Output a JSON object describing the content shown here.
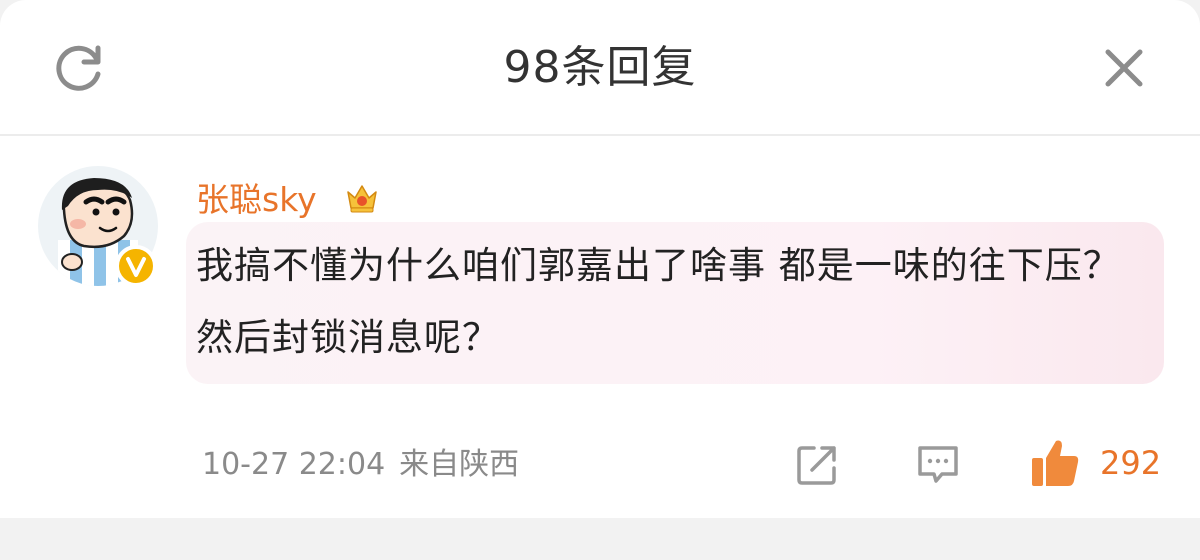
{
  "header": {
    "title": "98条回复"
  },
  "comment": {
    "username": "张聪sky",
    "text": "我搞不懂为什么咱们郭嘉出了啥事 都是一味的往下压？然后封锁消息呢？",
    "time": "10-27 22:04",
    "location": "来自陕西",
    "likes": "292"
  },
  "icons": {
    "refresh": "refresh-icon",
    "close": "close-icon",
    "crown": "crown-icon",
    "verified": "verified-badge-icon",
    "share": "share-icon",
    "comment": "comment-icon",
    "like": "thumbs-up-icon"
  },
  "colors": {
    "accent": "#e8742a",
    "verified": "#f5b400",
    "bubble": "#fcf1f5"
  }
}
